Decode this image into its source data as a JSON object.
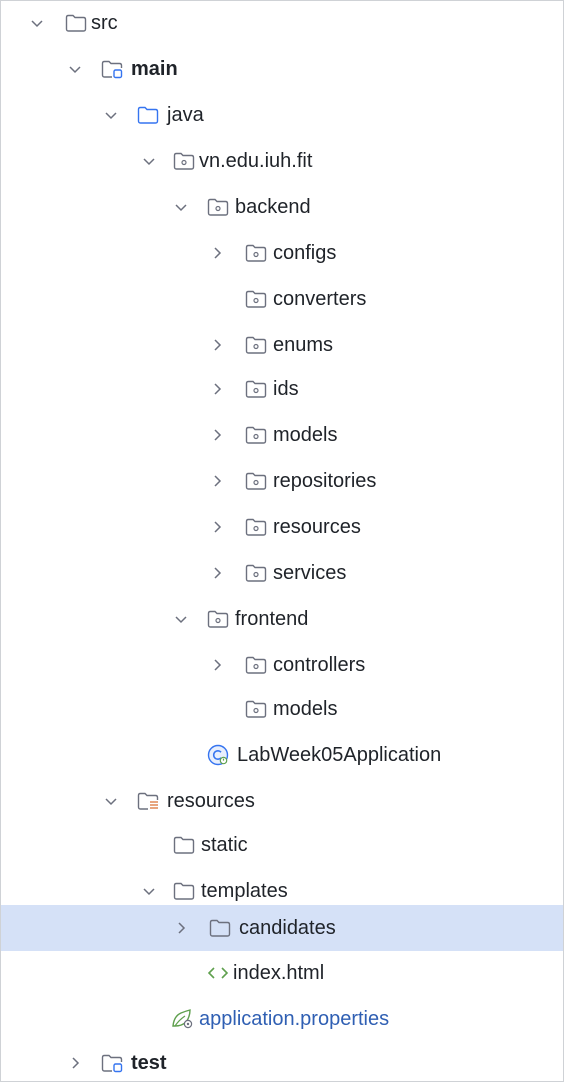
{
  "tree": {
    "items": [
      {
        "label": "src",
        "expanded": true,
        "icon": "folder-icon"
      },
      {
        "label": "main",
        "expanded": true,
        "icon": "source-root-folder-icon"
      },
      {
        "label": "java",
        "expanded": true,
        "icon": "sources-folder-icon"
      },
      {
        "label": "vn.edu.iuh.fit",
        "expanded": true,
        "icon": "package-icon"
      },
      {
        "label": "backend",
        "expanded": true,
        "icon": "package-icon"
      },
      {
        "label": "configs",
        "expanded": false,
        "icon": "package-icon"
      },
      {
        "label": "converters",
        "icon": "package-icon"
      },
      {
        "label": "enums",
        "expanded": false,
        "icon": "package-icon"
      },
      {
        "label": "ids",
        "expanded": false,
        "icon": "package-icon"
      },
      {
        "label": "models",
        "expanded": false,
        "icon": "package-icon"
      },
      {
        "label": "repositories",
        "expanded": false,
        "icon": "package-icon"
      },
      {
        "label": "resources",
        "expanded": false,
        "icon": "package-icon"
      },
      {
        "label": "services",
        "expanded": false,
        "icon": "package-icon"
      },
      {
        "label": "frontend",
        "expanded": true,
        "icon": "package-icon"
      },
      {
        "label": "controllers",
        "expanded": false,
        "icon": "package-icon"
      },
      {
        "label": "models",
        "icon": "package-icon"
      },
      {
        "label": "LabWeek05Application",
        "icon": "spring-boot-application-icon"
      },
      {
        "label": "resources",
        "expanded": true,
        "icon": "resources-root-folder-icon"
      },
      {
        "label": "static",
        "icon": "folder-icon"
      },
      {
        "label": "templates",
        "expanded": true,
        "icon": "folder-icon"
      },
      {
        "label": "candidates",
        "expanded": false,
        "icon": "folder-icon",
        "selected": true
      },
      {
        "label": "index.html",
        "icon": "html-file-icon"
      },
      {
        "label": "application.properties",
        "icon": "spring-properties-file-icon"
      },
      {
        "label": "test",
        "expanded": false,
        "icon": "test-root-folder-icon"
      }
    ]
  },
  "colors": {
    "selection": "#d5e1f7",
    "text": "#1f2329",
    "link_text": "#2f5fb3",
    "icon_blue": "#3574f0",
    "icon_gray": "#6c707e",
    "icon_green": "#5fa04e",
    "icon_orange": "#e08855"
  }
}
